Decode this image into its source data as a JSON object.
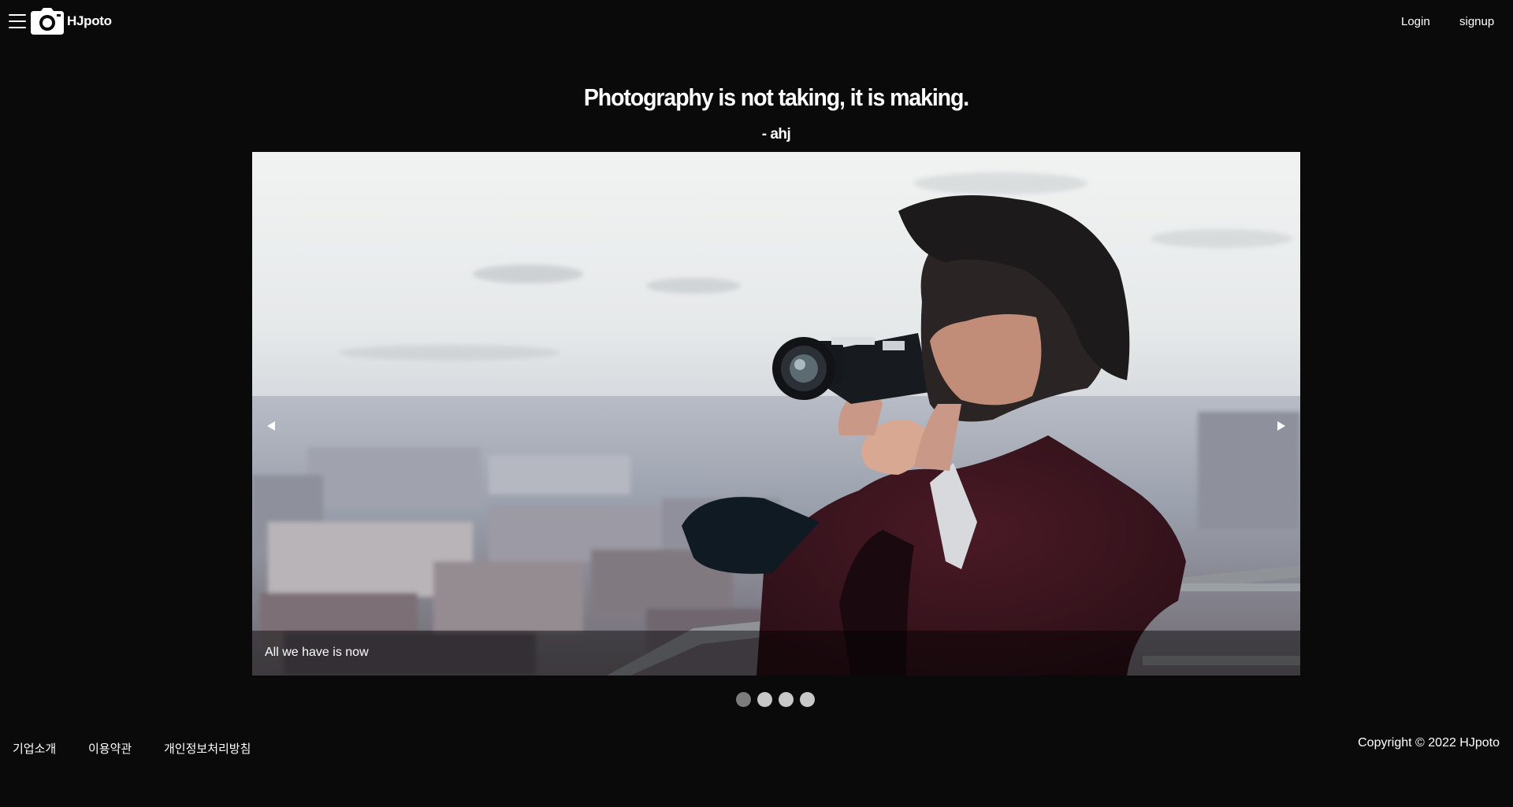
{
  "header": {
    "brand": "HJpoto",
    "login_label": "Login",
    "signup_label": "signup"
  },
  "hero": {
    "quote": "Photography is not taking, it is making.",
    "author": "- ahj"
  },
  "slider": {
    "caption": "All we have is now",
    "slide_count": 4,
    "active_index": 0
  },
  "footer": {
    "links": [
      "기업소개",
      "이용약관",
      "개인정보처리방침"
    ],
    "copyright": "Copyright © 2022 HJpoto"
  },
  "colors": {
    "background": "#0a0a0a",
    "text": "#ffffff",
    "dot_active": "#7c7c7c",
    "dot_inactive": "#c8c8c8"
  },
  "icons": {
    "menu": "hamburger-menu-icon",
    "logo": "camera-icon",
    "prev": "triangle-left-icon",
    "next": "triangle-right-icon"
  }
}
